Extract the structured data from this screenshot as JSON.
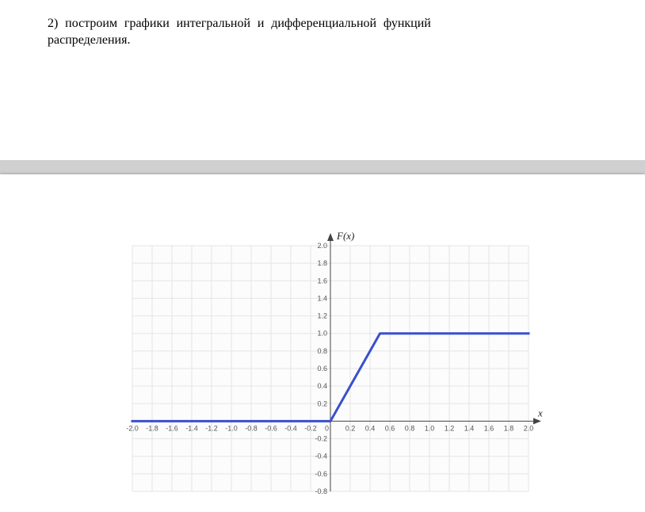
{
  "problem": {
    "number": "2)",
    "text_line1": "построим графики интегральной и дифференциальной функций",
    "text_line2": "распределения."
  },
  "chart_data": {
    "type": "line",
    "title": "",
    "ylabel": "F(x)",
    "xlabel": "x",
    "xlim": [
      -2.0,
      2.0
    ],
    "ylim": [
      -0.8,
      2.0
    ],
    "x_ticks": [
      -2.0,
      -1.8,
      -1.6,
      -1.4,
      -1.2,
      -1.0,
      -0.8,
      -0.6,
      -0.4,
      -0.2,
      0,
      0.2,
      0.4,
      0.6,
      0.8,
      1.0,
      1.2,
      1.4,
      1.6,
      1.8,
      2.0
    ],
    "y_ticks": [
      -0.8,
      -0.6,
      -0.4,
      -0.2,
      0,
      0.2,
      0.4,
      0.6,
      0.8,
      1.0,
      1.2,
      1.4,
      1.6,
      1.8,
      2.0
    ],
    "series": [
      {
        "name": "F(x)",
        "points": [
          {
            "x": -2.0,
            "y": 0.0
          },
          {
            "x": 0.0,
            "y": 0.0
          },
          {
            "x": 0.5,
            "y": 1.0
          },
          {
            "x": 2.0,
            "y": 1.0
          }
        ]
      }
    ]
  }
}
